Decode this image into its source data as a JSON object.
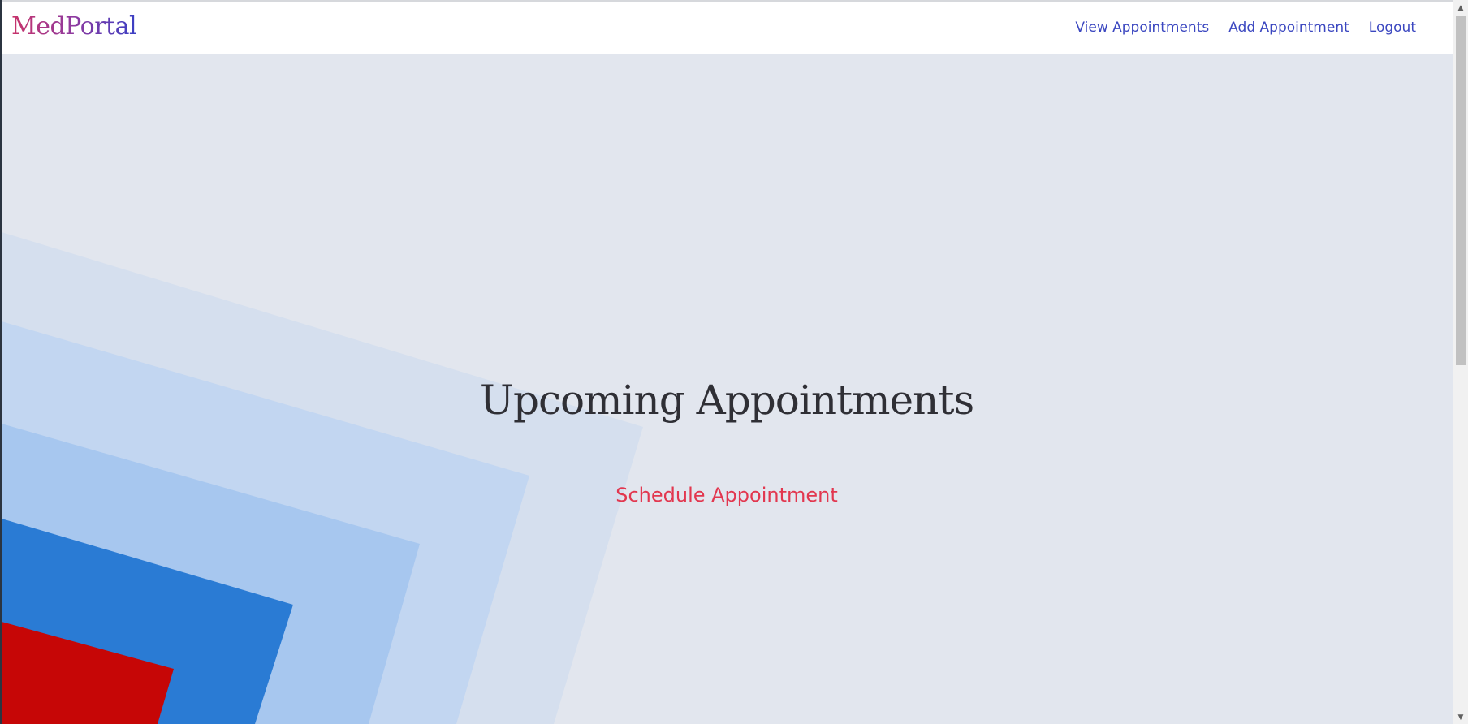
{
  "app": {
    "logo": "MedPortal"
  },
  "nav": {
    "items": [
      {
        "label": "View Appointments"
      },
      {
        "label": "Add Appointment"
      },
      {
        "label": "Logout"
      }
    ]
  },
  "hero": {
    "title": "Upcoming Appointments",
    "cta": "Schedule Appointment"
  },
  "colors": {
    "logo_start": "#c8336a",
    "logo_end": "#3a3fc4",
    "nav_link": "#3b47c0",
    "cta": "#e2374f",
    "background": "#e2e6ee"
  }
}
